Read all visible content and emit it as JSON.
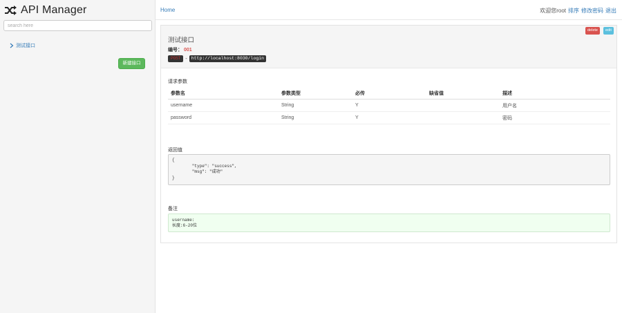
{
  "sidebar": {
    "brand_title": "API Manager",
    "search_placeholder": "search here",
    "nav_items": [
      {
        "label": "测试接口"
      }
    ],
    "new_button_label": "新建接口"
  },
  "topbar": {
    "home_label": "Home",
    "welcome_text": "欢迎您root",
    "links": [
      "排序",
      "修改密码",
      "退出"
    ]
  },
  "api": {
    "name": "测试接口",
    "id_label": "编号：",
    "id_value": "001",
    "method": "POST",
    "url": "http://localhost:8030/login",
    "delete_label": "delete",
    "edit_label": "edit"
  },
  "params": {
    "title": "请求参数",
    "columns": [
      "参数名",
      "参数类型",
      "必传",
      "缺省值",
      "描述"
    ],
    "rows": [
      [
        "username",
        "String",
        "Y",
        "",
        "用户名"
      ],
      [
        "password",
        "String",
        "Y",
        "",
        "密码"
      ]
    ]
  },
  "response": {
    "title": "返回值",
    "body": "{\n        \"type\": \"success\",\n        \"msg\": \"成功\"\n}"
  },
  "note": {
    "title": "备注",
    "body": "username:\n长度:6-20位"
  },
  "colors": {
    "success": "#5cb85c",
    "danger": "#d9534f",
    "info": "#5bc0de",
    "link": "#337ab7"
  }
}
